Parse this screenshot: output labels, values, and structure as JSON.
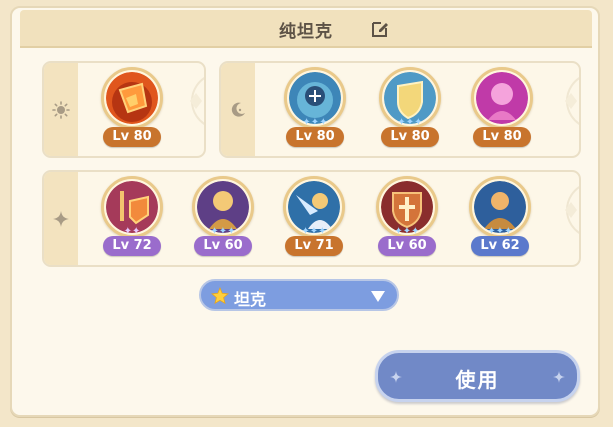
{
  "header": {
    "title": "纯坦克",
    "edit_icon": "edit-icon"
  },
  "groups": {
    "sun": {
      "icon": "sun-icon",
      "heroes": [
        {
          "level": "Lv 80",
          "badge_color": "#c8742d",
          "art": "flame-shield",
          "stars": 0
        }
      ]
    },
    "moon": {
      "icon": "moon-icon",
      "heroes": [
        {
          "level": "Lv 80",
          "badge_color": "#c8742d",
          "art": "water-guardian",
          "stars": 3
        },
        {
          "level": "Lv 80",
          "badge_color": "#c8742d",
          "art": "gold-shield",
          "stars": 3
        },
        {
          "level": "Lv 80",
          "badge_color": "#c8742d",
          "art": "pink-mage",
          "stars": 0
        }
      ]
    },
    "star": {
      "icon": "sparkle-icon",
      "heroes": [
        {
          "level": "Lv 72",
          "badge_color": "#9a6ccc",
          "art": "sword-shield",
          "stars": 2
        },
        {
          "level": "Lv 60",
          "badge_color": "#9a6ccc",
          "art": "blonde-knight",
          "stars": 3
        },
        {
          "level": "Lv 71",
          "badge_color": "#c8742d",
          "art": "blue-paladin",
          "stars": 3
        },
        {
          "level": "Lv 60",
          "badge_color": "#9a6ccc",
          "art": "cross-shield",
          "stars": 3
        },
        {
          "level": "Lv 62",
          "badge_color": "#5b79cc",
          "art": "blue-warrior",
          "stars": 3
        }
      ]
    }
  },
  "filter": {
    "label": "坦克",
    "icon": "star-icon"
  },
  "use_button": {
    "label": "使用"
  }
}
